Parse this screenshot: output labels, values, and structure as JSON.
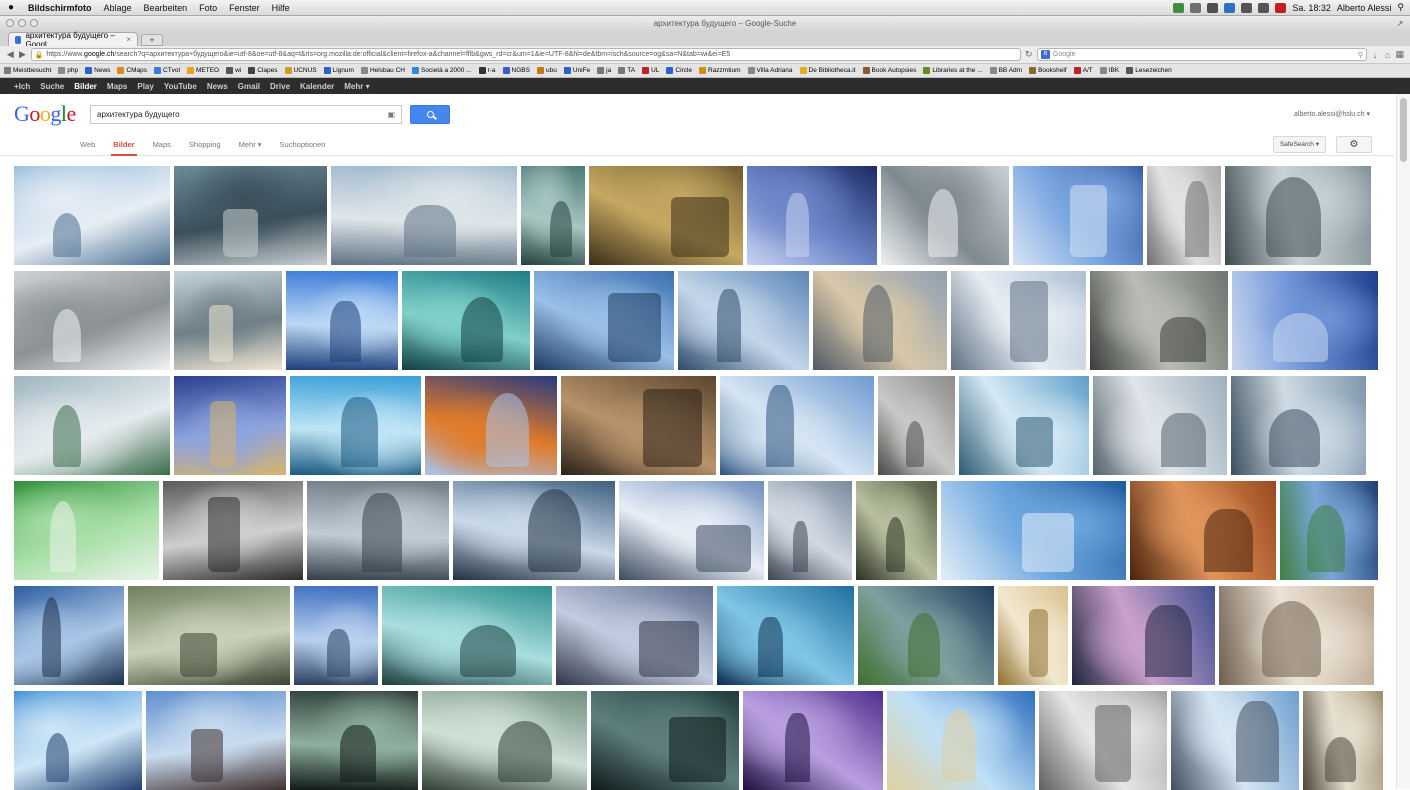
{
  "menubar": {
    "app": "Bildschirmfoto",
    "items": [
      "Ablage",
      "Bearbeiten",
      "Foto",
      "Fenster",
      "Hilfe"
    ],
    "clock": "Sa. 18:32",
    "user": "Alberto Alessi"
  },
  "window": {
    "title": "архитектура будущего – Google-Suche"
  },
  "tab": {
    "label": "архитектура будущего – Googl...",
    "new_tab": "+"
  },
  "navbar": {
    "url_prefix": "https://www.",
    "url_domain": "google.ch",
    "url_rest": "/search?q=архитектура+будущего&ie=utf-8&oe=utf-8&aq=t&rls=org.mozilla:de:official&client=firefox-a&channel=fflb&gws_rd=cr&um=1&ie=UTF-8&hl=de&tbm=isch&source=og&sa=N&tab=wi&ei=E5",
    "search_placeholder": "Google"
  },
  "bookmarks": [
    {
      "label": "Meistbesucht",
      "color": "#7a7a7a"
    },
    {
      "label": "php",
      "color": "#8a8a8a"
    },
    {
      "label": "News",
      "color": "#2f62c9"
    },
    {
      "label": "CMaps",
      "color": "#d88a1d"
    },
    {
      "label": "CTvol",
      "color": "#3d7bd8"
    },
    {
      "label": "METEO",
      "color": "#f0a020"
    },
    {
      "label": "wi",
      "color": "#555"
    },
    {
      "label": "Clapes",
      "color": "#444"
    },
    {
      "label": "UCNUS",
      "color": "#c9a11f"
    },
    {
      "label": "Lignum",
      "color": "#2f62c9"
    },
    {
      "label": "Helsbau CH",
      "color": "#888"
    },
    {
      "label": "Società a 2000 ...",
      "color": "#2f8ad9"
    },
    {
      "label": "r-a",
      "color": "#333"
    },
    {
      "label": "NGBS",
      "color": "#3a5fc0"
    },
    {
      "label": "ubu",
      "color": "#c07a1a"
    },
    {
      "label": "UniFe",
      "color": "#2f62c9"
    },
    {
      "label": "ja",
      "color": "#777"
    },
    {
      "label": "TA",
      "color": "#777"
    },
    {
      "label": "UL",
      "color": "#c02020"
    },
    {
      "label": "Circle",
      "color": "#2f62c9"
    },
    {
      "label": "Razzmtium",
      "color": "#d68a1a"
    },
    {
      "label": "Villa Adriana",
      "color": "#888"
    },
    {
      "label": "De Bibliotheca.it",
      "color": "#e0b020"
    },
    {
      "label": "Book Autopsies",
      "color": "#8a5a2a"
    },
    {
      "label": "Libraries at the ...",
      "color": "#6a8a2a"
    },
    {
      "label": "BB Adm",
      "color": "#888"
    },
    {
      "label": "Bookshelf",
      "color": "#8a6a2a"
    },
    {
      "label": "A/T",
      "color": "#c02020"
    },
    {
      "label": "IBK",
      "color": "#888"
    },
    {
      "label": "Lesezeichen",
      "color": "#555"
    }
  ],
  "gbar": {
    "links": [
      "+Ich",
      "Suche",
      "Bilder",
      "Maps",
      "Play",
      "YouTube",
      "News",
      "Gmail",
      "Drive",
      "Kalender",
      "Mehr ▾"
    ],
    "active_index": 2
  },
  "google": {
    "logo": [
      "G",
      "o",
      "o",
      "g",
      "l",
      "e"
    ],
    "query": "архитектура будущего",
    "account": "alberto.alessi@hslu.ch ▾"
  },
  "search_tabs": {
    "items": [
      "Web",
      "Bilder",
      "Maps",
      "Shopping",
      "Mehr ▾",
      "Suchoptionen"
    ],
    "active_index": 1,
    "safesearch": "SafeSearch ▾",
    "gear": "⚙"
  },
  "image_rows": [
    {
      "h": 99,
      "items": [
        {
          "w": 156,
          "colors": [
            "#8fb6d9",
            "#e7eef5",
            "#4a6f8f"
          ],
          "label": "futuristic waterfall skyscraper"
        },
        {
          "w": 153,
          "colors": [
            "#6b8a97",
            "#3a4f5a",
            "#c8cfd1"
          ],
          "label": "hovering city structure"
        },
        {
          "w": 186,
          "colors": [
            "#9fb8cc",
            "#dfe6ea",
            "#5f7383"
          ],
          "label": "future city panorama"
        },
        {
          "w": 64,
          "colors": [
            "#4d7a76",
            "#a8c6c2",
            "#23403d"
          ],
          "label": "green tower"
        },
        {
          "w": 154,
          "colors": [
            "#6e5a2f",
            "#c7a862",
            "#3a2f18"
          ],
          "label": "spiral shell building"
        },
        {
          "w": 130,
          "colors": [
            "#1b2a66",
            "#6d86c9",
            "#c9d3f0"
          ],
          "label": "glass egg building"
        },
        {
          "w": 128,
          "colors": [
            "#c9d0d4",
            "#7f8a90",
            "#eef1f2"
          ],
          "label": "twisted white tower"
        },
        {
          "w": 130,
          "colors": [
            "#2a4f9a",
            "#7aa6e0",
            "#d7e3f4"
          ],
          "label": "waterfront museum"
        },
        {
          "w": 74,
          "colors": [
            "#a9a9a9",
            "#e2e2e2",
            "#6f6f6f"
          ],
          "label": "facade texture"
        },
        {
          "w": 146,
          "colors": [
            "#7e8e94",
            "#c9d3d6",
            "#3d4a4f"
          ],
          "label": "tower in sea"
        }
      ]
    },
    {
      "h": 99,
      "items": [
        {
          "w": 156,
          "colors": [
            "#d0d3d5",
            "#8b9296",
            "#f1f2f3"
          ],
          "label": "wing sculpture"
        },
        {
          "w": 108,
          "colors": [
            "#c5d3dc",
            "#6f7f88",
            "#efe7d3"
          ],
          "label": "mushroom tower"
        },
        {
          "w": 112,
          "colors": [
            "#3a7bd6",
            "#bcd8f5",
            "#1d3f7a"
          ],
          "label": "blue tower facade"
        },
        {
          "w": 128,
          "colors": [
            "#1f7d86",
            "#7fd0c8",
            "#0e3f44"
          ],
          "label": "floating eco city"
        },
        {
          "w": 140,
          "colors": [
            "#3c6fb0",
            "#9ac0e8",
            "#1c3a60"
          ],
          "label": "waterfront ring"
        },
        {
          "w": 131,
          "colors": [
            "#5c86b8",
            "#c4d6ea",
            "#2f4a6a"
          ],
          "label": "curved building"
        },
        {
          "w": 134,
          "colors": [
            "#8ea0b2",
            "#d9c7a8",
            "#4f5a66"
          ],
          "label": "dome structure"
        },
        {
          "w": 135,
          "colors": [
            "#aebfd0",
            "#e6edf3",
            "#5f7083"
          ],
          "label": "spire towers"
        },
        {
          "w": 138,
          "colors": [
            "#6f7470",
            "#b9bdb5",
            "#3a3d3a"
          ],
          "label": "industrial futurism"
        },
        {
          "w": 146,
          "colors": [
            "#1e3f8c",
            "#6f95d9",
            "#c9d6ee"
          ],
          "label": "tall blue towers"
        }
      ]
    },
    {
      "h": 99,
      "items": [
        {
          "w": 156,
          "colors": [
            "#9fb5c0",
            "#e4ebee",
            "#3a6b4a"
          ],
          "label": "layered green building"
        },
        {
          "w": 112,
          "colors": [
            "#2a3f8f",
            "#8da3df",
            "#d6b36a"
          ],
          "label": "night city craft"
        },
        {
          "w": 131,
          "colors": [
            "#3aa0d8",
            "#bfe5f6",
            "#1c5a80"
          ],
          "label": "glass arches"
        },
        {
          "w": 132,
          "colors": [
            "#2a3a7f",
            "#e07b2a",
            "#a7c4ef"
          ],
          "label": "eye sphere building"
        },
        {
          "w": 155,
          "colors": [
            "#5a4630",
            "#b8926a",
            "#2a2118"
          ],
          "label": "cantilever tower"
        },
        {
          "w": 154,
          "colors": [
            "#6f9ad0",
            "#d6e5f3",
            "#2f557f"
          ],
          "label": "sky sculpture"
        },
        {
          "w": 77,
          "colors": [
            "#8c8c8a",
            "#c8c8c6",
            "#4a4a48"
          ],
          "label": "sketch"
        },
        {
          "w": 130,
          "colors": [
            "#5f9fc9",
            "#d5e9f4",
            "#2d5a73"
          ],
          "label": "balcony tower"
        },
        {
          "w": 134,
          "colors": [
            "#9fb0bd",
            "#dfe5ea",
            "#56636d"
          ],
          "label": "city block"
        },
        {
          "w": 135,
          "colors": [
            "#7f98ad",
            "#cfdbe4",
            "#3d4f5e"
          ],
          "label": "arch building"
        }
      ]
    },
    {
      "h": 99,
      "items": [
        {
          "w": 145,
          "colors": [
            "#2f8f3a",
            "#a9e0a8",
            "#e9f3e9"
          ],
          "label": "white cubes on green"
        },
        {
          "w": 140,
          "colors": [
            "#5a5a5a",
            "#cfcfcf",
            "#2a2a2a"
          ],
          "label": "white lattice"
        },
        {
          "w": 142,
          "colors": [
            "#6f7c88",
            "#c2ccd4",
            "#33404a"
          ],
          "label": "aerial future city"
        },
        {
          "w": 162,
          "colors": [
            "#3f5f7f",
            "#c9d9ea",
            "#1f2f3f"
          ],
          "label": "white wave"
        },
        {
          "w": 145,
          "colors": [
            "#6f8fbf",
            "#e8eef6",
            "#3b4a5e"
          ],
          "label": "spiral white tower"
        },
        {
          "w": 84,
          "colors": [
            "#7a8a9c",
            "#d0d8e2",
            "#3a4450"
          ],
          "label": "skyscraper"
        },
        {
          "w": 81,
          "colors": [
            "#4f5a3f",
            "#b7bf9f",
            "#2a2f20"
          ],
          "label": "vertical garden"
        },
        {
          "w": 185,
          "colors": [
            "#1f5a9f",
            "#6fa8e0",
            "#e4eef7"
          ],
          "label": "glass aquarium building"
        },
        {
          "w": 146,
          "colors": [
            "#9a4a1f",
            "#e0955a",
            "#4a220e"
          ],
          "label": "red wave"
        },
        {
          "w": 98,
          "colors": [
            "#1f3f6f",
            "#79a6d9",
            "#3f7f3f"
          ],
          "label": "green stacked tower"
        }
      ]
    },
    {
      "h": 99,
      "items": [
        {
          "w": 110,
          "colors": [
            "#2f5f9f",
            "#a9c6e6",
            "#1c2f4f"
          ],
          "label": "tower in clouds"
        },
        {
          "w": 162,
          "colors": [
            "#6f7f5f",
            "#c9d2b9",
            "#3a4230"
          ],
          "label": "green hillside city"
        },
        {
          "w": 84,
          "colors": [
            "#3f6fbf",
            "#b9d0ef",
            "#2a3f5f"
          ],
          "label": "twisting tower"
        },
        {
          "w": 170,
          "colors": [
            "#2f8f8f",
            "#a9dfdf",
            "#1c3f3f"
          ],
          "label": "floating ship"
        },
        {
          "w": 157,
          "colors": [
            "#5f6f8f",
            "#c2cbe0",
            "#2f3546"
          ],
          "label": "domed city"
        },
        {
          "w": 137,
          "colors": [
            "#1f6f9f",
            "#7fc6e6",
            "#0e2f4f"
          ],
          "label": "floating island"
        },
        {
          "w": 136,
          "colors": [
            "#1f3f5f",
            "#7fa09f",
            "#3f6f2f"
          ],
          "label": "eco lily pad"
        },
        {
          "w": 70,
          "colors": [
            "#d9c18f",
            "#f2e8cf",
            "#8f6f2f"
          ],
          "label": "illustrated tower"
        },
        {
          "w": 143,
          "colors": [
            "#3f4f8f",
            "#c9a0c9",
            "#1f243f"
          ],
          "label": "ring building at dusk"
        },
        {
          "w": 155,
          "colors": [
            "#b9a58f",
            "#ece3d6",
            "#6f5f4f"
          ],
          "label": "desert tower"
        }
      ]
    },
    {
      "h": 99,
      "items": [
        {
          "w": 128,
          "colors": [
            "#3f8fd9",
            "#cfe6f7",
            "#1f3f6f"
          ],
          "label": "wave pavilion"
        },
        {
          "w": 140,
          "colors": [
            "#5f8fcf",
            "#c9dcef",
            "#3f3030"
          ],
          "label": "white towers"
        },
        {
          "w": 128,
          "colors": [
            "#2f3f3a",
            "#8fb09f",
            "#101a16"
          ],
          "label": "night station"
        },
        {
          "w": 165,
          "colors": [
            "#6f8f7f",
            "#cfe0d6",
            "#2f3f36"
          ],
          "label": "bridge city"
        },
        {
          "w": 148,
          "colors": [
            "#1f3a3a",
            "#5f7f7f",
            "#0e1a1a"
          ],
          "label": "dark fortress"
        },
        {
          "w": 140,
          "colors": [
            "#4f2f8f",
            "#b99fe0",
            "#1f103f"
          ],
          "label": "floating platforms"
        },
        {
          "w": 148,
          "colors": [
            "#2f6fbf",
            "#bfe0f6",
            "#e0d0a0"
          ],
          "label": "white sail"
        },
        {
          "w": 128,
          "colors": [
            "#9f9f9f",
            "#e6e6e6",
            "#5f5f5f"
          ],
          "label": "sphere lattice"
        },
        {
          "w": 128,
          "colors": [
            "#6f9fcf",
            "#d6e6f3",
            "#3f4f5f"
          ],
          "label": "diamond tower"
        },
        {
          "w": 80,
          "colors": [
            "#9f8f6f",
            "#e6dfcf",
            "#4f463a"
          ],
          "label": "stacked blocks"
        }
      ]
    }
  ]
}
